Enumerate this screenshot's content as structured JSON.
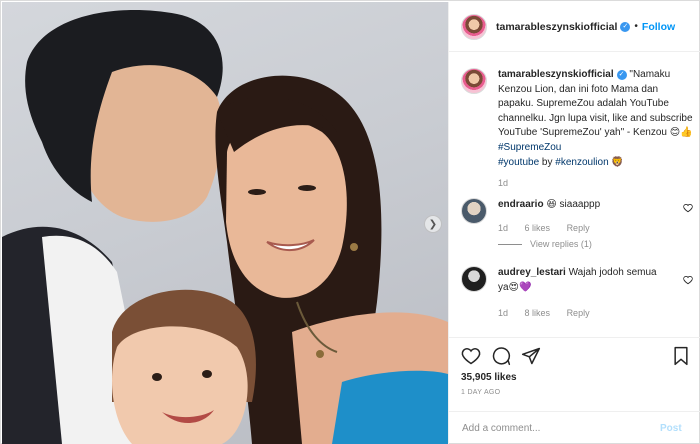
{
  "post": {
    "username": "tamarableszynskiofficial",
    "follow_label": "Follow",
    "dot": "•"
  },
  "caption": {
    "username": "tamarableszynskiofficial",
    "text": " \"Namaku Kenzou Lion, dan ini foto Mama dan papaku. SupremeZou adalah YouTube channelku. Jgn lupa visit, like and subscribe YouTube 'SupremeZou' yah\" - Kenzou 😊👍 ",
    "tag1": "#SupremeZou",
    "tag2": "#youtube",
    "by": " by ",
    "tag3": "#kenzoulion",
    "emoji_end": " 🦁",
    "time": "1d"
  },
  "comments": [
    {
      "username": "endraario",
      "text": " 😆 siaaappp",
      "time": "1d",
      "likes": "6 likes",
      "reply": "Reply",
      "view_replies": "View replies (1)"
    },
    {
      "username": "audrey_lestari",
      "text": " Wajah jodoh semua ya😍💜",
      "time": "1d",
      "likes": "8 likes",
      "reply": "Reply"
    }
  ],
  "icons": {
    "like": "heart-icon",
    "comment": "comment-icon",
    "share": "share-icon",
    "save": "bookmark-icon",
    "next": "chevron-right-icon"
  },
  "stats": {
    "likes": "35,905 likes",
    "time_ago": "1 DAY AGO"
  },
  "add_comment": {
    "placeholder": "Add a comment...",
    "post_label": "Post"
  },
  "colors": {
    "accent": "#0095f6",
    "verified": "#3897f0",
    "post_disabled": "#b2dffc",
    "muted": "#8e8e8e"
  }
}
